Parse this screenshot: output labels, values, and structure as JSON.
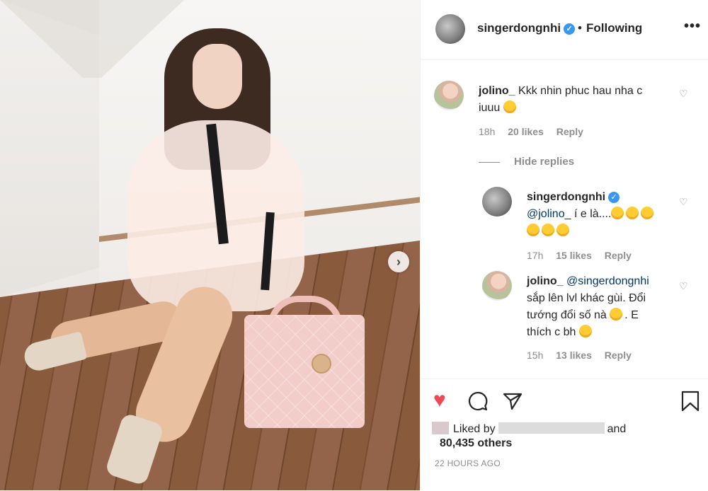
{
  "header": {
    "username": "singerdongnhi",
    "separator": "•",
    "follow_status": "Following",
    "more_label": "•••"
  },
  "comments": [
    {
      "username": "jolino_",
      "text_line1": "Kkk nhin phuc hau nha c",
      "text_line2": "iuuu",
      "time": "18h",
      "likes": "20 likes",
      "reply": "Reply"
    }
  ],
  "hide_replies": "Hide replies",
  "replies": [
    {
      "username": "singerdongnhi",
      "mention": "@jolino_",
      "text": "í e là....",
      "time": "17h",
      "likes": "15 likes",
      "reply": "Reply"
    },
    {
      "username": "jolino_",
      "mention": "@singerdongnhi",
      "line1": "sắp lên lvl khác gùi. Đổi",
      "line2": "tướng đổi số nà",
      "line2b": ". E",
      "line3": "thích c bh",
      "time": "15h",
      "likes": "13 likes",
      "reply": "Reply"
    }
  ],
  "actions": {
    "like_icon": "heart-filled-icon",
    "comment_icon": "comment-icon",
    "share_icon": "share-icon",
    "save_icon": "bookmark-icon",
    "liked_by_label": "Liked by",
    "liked_by_and": "and",
    "others": "80,435 others",
    "time_ago": "22 HOURS AGO"
  },
  "colors": {
    "like_red": "#ed4956",
    "verified_blue": "#3897f0",
    "meta_gray": "#8e8e8e"
  }
}
